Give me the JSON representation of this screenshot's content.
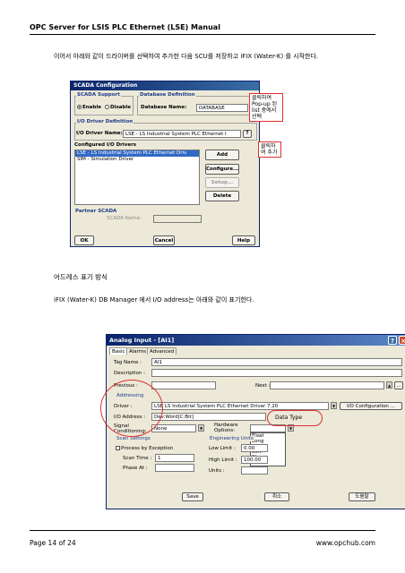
{
  "header": {
    "title": "OPC Server for LSIS PLC Ethernet (LSE) Manual"
  },
  "intro": "이어서 아래와 같이 드라이버를 선택하여 추가한 다음 SCU를 저장하고 iFIX (Water-K) 를 시작한다.",
  "scada_dialog": {
    "title": "SCADA Configuration",
    "scada_support": {
      "label": "SCADA Support",
      "enable": "Enable",
      "disable": "Disable",
      "selected": "Enable"
    },
    "database_definition": {
      "label": "Database Definition",
      "name_label": "Database Name:",
      "name_value": "DATABASE"
    },
    "io_driver_definition": {
      "label": "I/O Driver Definition",
      "name_label": "I/O Driver Name:",
      "name_value": "LSE - LS Industrial System PLC  Ethernet I",
      "help_btn": "?"
    },
    "configured_label": "Configured I/O Drivers",
    "drivers": [
      "LSE - LS Industrial System PLC Ethernet Driv",
      "SIM - Simulation Driver"
    ],
    "buttons": {
      "add": "Add",
      "configure": "Configure...",
      "setup": "Setup...",
      "delete": "Delete"
    },
    "partner": {
      "label": "Partner SCADA",
      "name_label": "SCADA Name:"
    },
    "footer_buttons": {
      "ok": "OK",
      "cancel": "Cancel",
      "help": "Help"
    },
    "note1": "클릭하여 Pop-up 된 list 중에서 선택",
    "note2": "클릭하여 추가"
  },
  "section_title": "어드레스 표기 방식",
  "section_text": "iFIX (Water-K) DB Manager 에서 I/O address는 아래와 같이 표기한다.",
  "analog_dialog": {
    "title": "Analog Input - [AI1]",
    "tabs": [
      "Basic",
      "Alarms",
      "Advanced"
    ],
    "tag_name_label": "Tag Name :",
    "tag_name_value": "AI1",
    "description_label": "Description :",
    "previous_label": "Previous :",
    "next_label": "Next :",
    "addressing_label": "Addressing",
    "driver_label": "Driver :",
    "driver_value": "LSE    LS Industrial System PLC   Ethernet Driver  7.20",
    "io_config_btn": "I/O Configuration ...",
    "io_address_label": "I/O Address :",
    "io_address_value": "Dev:Word[C:Bit]",
    "signal_label": "Signal Conditioning:",
    "signal_value": "None",
    "hardware_label": "Hardware Options:",
    "data_type_note": "Data Type",
    "data_types": [
      "Float",
      "Long",
      "None",
      "Sint",
      "SLong",
      "Uint"
    ],
    "scan_label": "Scan Settings",
    "process_exception": "Process by Exception",
    "scan_time_label": "Scan Time :",
    "scan_time_value": "1",
    "phase_label": "Phase At :",
    "eng_label": "Engineering Units",
    "low_label": "Low Limit :",
    "low_value": "0.00",
    "high_label": "High Limit :",
    "high_value": "100.00",
    "units_label": "Units :",
    "buttons": {
      "save": "Save",
      "cancel": "취소",
      "help": "도움말"
    }
  },
  "footer": {
    "page": "Page 14 of 24",
    "site": "www.opchub.com"
  }
}
